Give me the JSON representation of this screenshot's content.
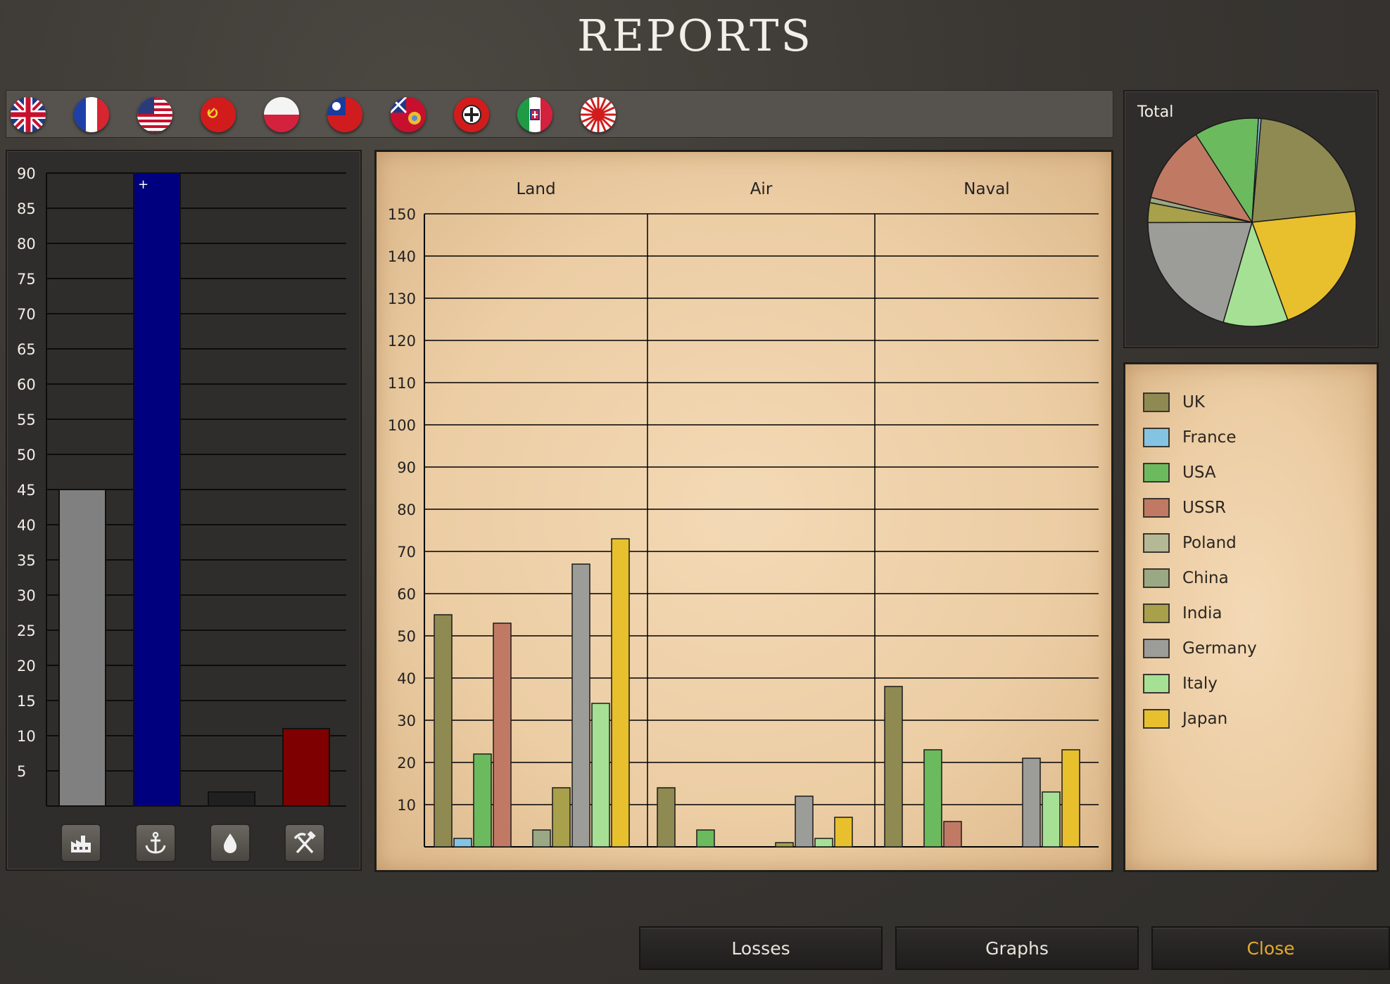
{
  "title": "REPORTS",
  "flags": [
    {
      "name": "uk-flag-icon",
      "selected": true
    },
    {
      "name": "france-flag-icon"
    },
    {
      "name": "usa-flag-icon"
    },
    {
      "name": "ussr-flag-icon"
    },
    {
      "name": "poland-flag-icon"
    },
    {
      "name": "china-flag-icon"
    },
    {
      "name": "india-flag-icon"
    },
    {
      "name": "germany-flag-icon"
    },
    {
      "name": "italy-flag-icon"
    },
    {
      "name": "japan-flag-icon"
    }
  ],
  "resources": {
    "buttons": [
      "factory-icon",
      "anchor-icon",
      "oil-drop-icon",
      "pickaxe-hammer-icon"
    ],
    "marker": "+"
  },
  "chart_data": [
    {
      "type": "bar",
      "ylim": [
        0,
        90
      ],
      "yticks": [
        5,
        10,
        15,
        20,
        25,
        30,
        35,
        40,
        45,
        50,
        55,
        60,
        65,
        70,
        75,
        80,
        85,
        90
      ],
      "ytick_labels": [
        "5",
        "10",
        "15",
        "20",
        "25",
        "30",
        "35",
        "40",
        "45",
        "50",
        "55",
        "60",
        "65",
        "70",
        "75",
        "80",
        "85",
        "90"
      ],
      "grid": true,
      "bars": [
        {
          "value": 45,
          "color": "#808080"
        },
        {
          "value": 90,
          "color": "#00007f"
        },
        {
          "value": 2,
          "color": "#202020"
        },
        {
          "value": 11,
          "color": "#7f0000"
        }
      ]
    },
    {
      "type": "bar",
      "ylim": [
        0,
        150
      ],
      "yticks": [
        10,
        20,
        30,
        40,
        50,
        60,
        70,
        80,
        90,
        100,
        110,
        120,
        130,
        140,
        150
      ],
      "ytick_labels": [
        "10",
        "20",
        "30",
        "40",
        "50",
        "60",
        "70",
        "80",
        "90",
        "100",
        "110",
        "120",
        "130",
        "140",
        "150"
      ],
      "grid": true,
      "categories": [
        "Land",
        "Air",
        "Naval"
      ],
      "series": [
        {
          "name": "UK",
          "color": "#8e8a52",
          "values": [
            55,
            14,
            38
          ]
        },
        {
          "name": "France",
          "color": "#84c4e2",
          "values": [
            2,
            0,
            0
          ]
        },
        {
          "name": "USA",
          "color": "#6cba5e",
          "values": [
            22,
            4,
            23
          ]
        },
        {
          "name": "USSR",
          "color": "#c07a64",
          "values": [
            53,
            0,
            6
          ]
        },
        {
          "name": "Poland",
          "color": "#b4b894",
          "values": [
            0,
            0,
            0
          ]
        },
        {
          "name": "China",
          "color": "#9aa884",
          "values": [
            4,
            0,
            0
          ]
        },
        {
          "name": "India",
          "color": "#a8a04a",
          "values": [
            14,
            1,
            0
          ]
        },
        {
          "name": "Germany",
          "color": "#9c9c98",
          "values": [
            67,
            12,
            21
          ]
        },
        {
          "name": "Italy",
          "color": "#a6e095",
          "values": [
            34,
            2,
            13
          ]
        },
        {
          "name": "Japan",
          "color": "#e8c02e",
          "values": [
            73,
            7,
            23
          ]
        }
      ]
    },
    {
      "type": "pie",
      "title": "Total",
      "slices": [
        {
          "name": "UK",
          "color": "#8e8a52",
          "value": 107
        },
        {
          "name": "Japan",
          "color": "#e8c02e",
          "value": 103
        },
        {
          "name": "Italy",
          "color": "#a6e095",
          "value": 49
        },
        {
          "name": "Germany",
          "color": "#9c9c98",
          "value": 100
        },
        {
          "name": "India",
          "color": "#a8a04a",
          "value": 15
        },
        {
          "name": "China",
          "color": "#9aa884",
          "value": 4
        },
        {
          "name": "USSR",
          "color": "#c07a64",
          "value": 59
        },
        {
          "name": "USA",
          "color": "#6cba5e",
          "value": 49
        },
        {
          "name": "France",
          "color": "#84c4e2",
          "value": 2
        }
      ]
    }
  ],
  "legend": [
    {
      "label": "UK",
      "color": "#8e8a52"
    },
    {
      "label": "France",
      "color": "#84c4e2"
    },
    {
      "label": "USA",
      "color": "#6cba5e"
    },
    {
      "label": "USSR",
      "color": "#c07a64"
    },
    {
      "label": "Poland",
      "color": "#b4b894"
    },
    {
      "label": "China",
      "color": "#9aa884"
    },
    {
      "label": "India",
      "color": "#a8a04a"
    },
    {
      "label": "Germany",
      "color": "#9c9c98"
    },
    {
      "label": "Italy",
      "color": "#a6e095"
    },
    {
      "label": "Japan",
      "color": "#e8c02e"
    }
  ],
  "buttons": {
    "losses": "Losses",
    "graphs": "Graphs",
    "close": "Close"
  }
}
